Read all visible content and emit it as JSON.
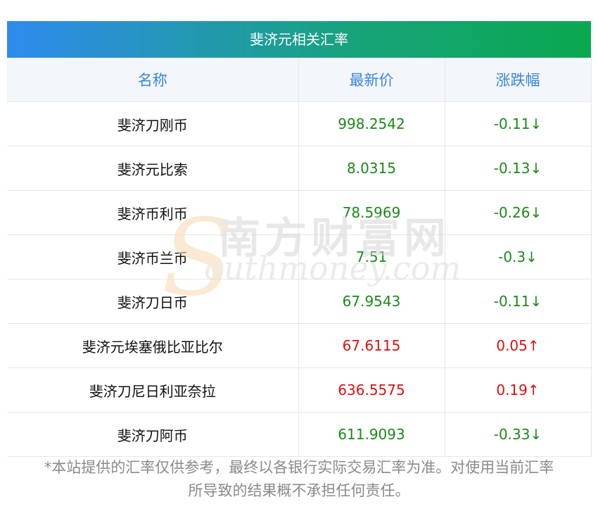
{
  "title": "斐济元相关汇率",
  "headers": {
    "name": "名称",
    "price": "最新价",
    "change": "涨跌幅"
  },
  "colors": {
    "down": "#1a8a1a",
    "up": "#e01010",
    "header_text": "#3a86d8"
  },
  "rows": [
    {
      "name": "斐济刀刚币",
      "price": "998.2542",
      "change": "-0.11↓",
      "dir": "down"
    },
    {
      "name": "斐济元比索",
      "price": "8.0315",
      "change": "-0.13↓",
      "dir": "down"
    },
    {
      "name": "斐济币利币",
      "price": "78.5969",
      "change": "-0.26↓",
      "dir": "down"
    },
    {
      "name": "斐济币兰币",
      "price": "7.51",
      "change": "-0.3↓",
      "dir": "down"
    },
    {
      "name": "斐济刀日币",
      "price": "67.9543",
      "change": "-0.11↓",
      "dir": "down"
    },
    {
      "name": "斐济元埃塞俄比亚比尔",
      "price": "67.6115",
      "change": "0.05↑",
      "dir": "up"
    },
    {
      "name": "斐济刀尼日利亚奈拉",
      "price": "636.5575",
      "change": "0.19↑",
      "dir": "up"
    },
    {
      "name": "斐济刀阿币",
      "price": "611.9093",
      "change": "-0.33↓",
      "dir": "down"
    }
  ],
  "footnote": {
    "line1": "*本站提供的汇率仅供参考，最终以各银行实际交易汇率为准。对使用当前汇率",
    "line2": "所导致的结果概不承担任何责任。"
  },
  "watermark": {
    "cn": "南方财富网",
    "en": "outhmoney.com",
    "s": "S"
  }
}
